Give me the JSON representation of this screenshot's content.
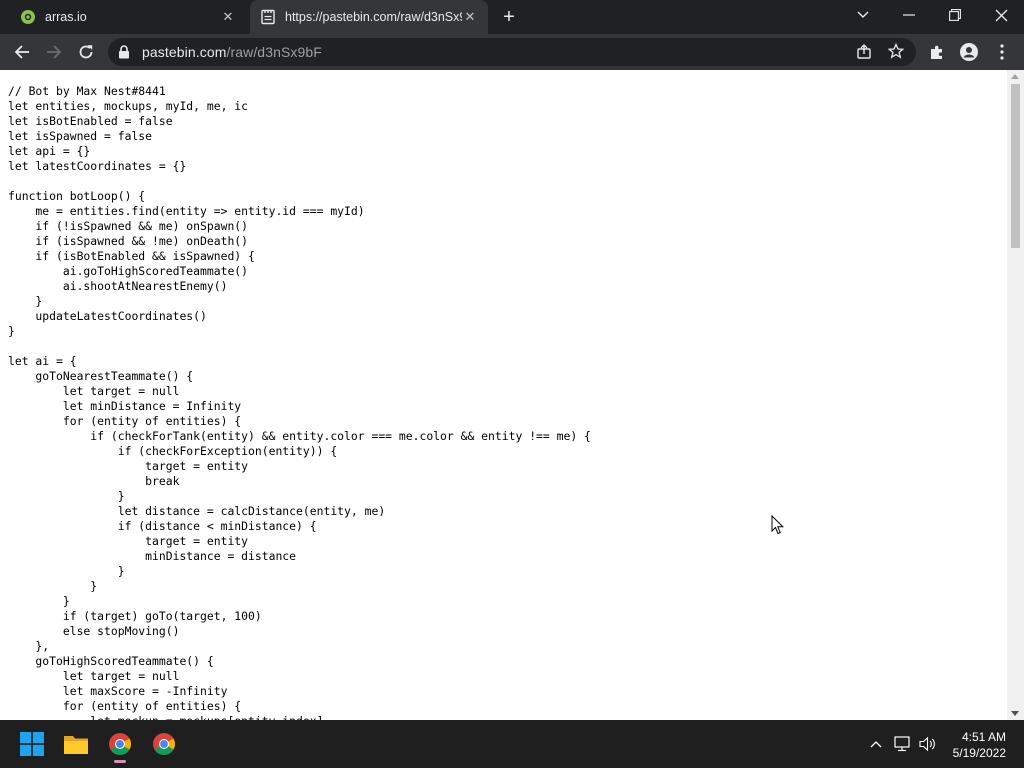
{
  "browser": {
    "tabs": [
      {
        "title": "arras.io",
        "active": false
      },
      {
        "title": "https://pastebin.com/raw/d3nSx9",
        "active": true
      }
    ],
    "address": {
      "host": "pastebin.com",
      "path": "/raw/d3nSx9bF"
    }
  },
  "icons": {
    "tab1_favicon": "arras-favicon-icon",
    "tab2_favicon": "pastebin-favicon-icon",
    "tab_close": "close-icon",
    "new_tab": "plus-icon",
    "tab_search": "chevron-down-icon",
    "minimize": "minimize-icon",
    "restore": "restore-icon",
    "close_window": "close-icon",
    "back": "back-arrow-icon",
    "forward": "forward-arrow-icon",
    "reload": "reload-icon",
    "lock": "lock-icon",
    "share": "share-icon",
    "bookmark": "star-icon",
    "extensions": "puzzle-icon",
    "profile": "profile-icon",
    "menu": "kebab-menu-icon"
  },
  "code": "// Bot by Max Nest#8441\nlet entities, mockups, myId, me, ic\nlet isBotEnabled = false\nlet isSpawned = false\nlet api = {}\nlet latestCoordinates = {}\n\nfunction botLoop() {\n    me = entities.find(entity => entity.id === myId)\n    if (!isSpawned && me) onSpawn()\n    if (isSpawned && !me) onDeath()\n    if (isBotEnabled && isSpawned) {\n        ai.goToHighScoredTeammate()\n        ai.shootAtNearestEnemy()\n    }\n    updateLatestCoordinates()\n}\n\nlet ai = {\n    goToNearestTeammate() {\n        let target = null\n        let minDistance = Infinity\n        for (entity of entities) {\n            if (checkForTank(entity) && entity.color === me.color && entity !== me) {\n                if (checkForException(entity)) {\n                    target = entity\n                    break\n                }\n                let distance = calcDistance(entity, me)\n                if (distance < minDistance) {\n                    target = entity\n                    minDistance = distance\n                }\n            }\n        }\n        if (target) goTo(target, 100)\n        else stopMoving()\n    },\n    goToHighScoredTeammate() {\n        let target = null\n        let maxScore = -Infinity\n        for (entity of entities) {\n            let mockup = mockups[entity.index]",
  "taskbar": {
    "apps": [
      "windows-start-icon",
      "file-explorer-icon",
      "chrome-icon",
      "chrome-icon"
    ],
    "time": "4:51 AM",
    "date": "5/19/2022"
  },
  "colors": {
    "tab_bg": "#202124",
    "toolbar_bg": "#35363a",
    "page_bg": "#ffffff"
  }
}
